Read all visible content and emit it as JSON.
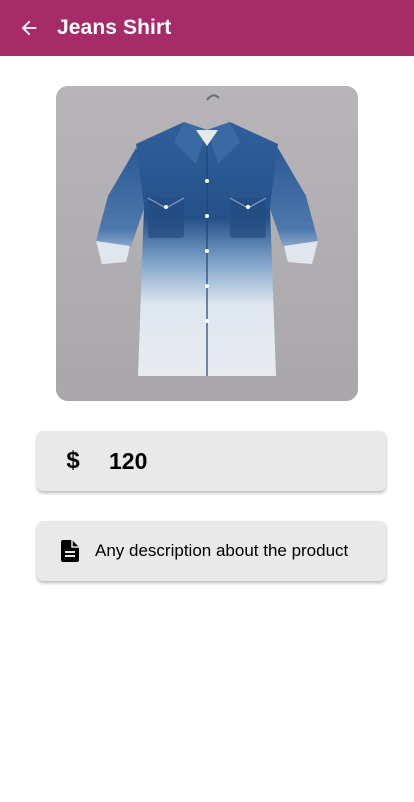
{
  "app_bar": {
    "title": "Jeans Shirt",
    "background_color": "#a62b68",
    "back_icon": "arrow-back-icon"
  },
  "product": {
    "image_icon": "jeans-shirt-photo"
  },
  "price": {
    "icon_glyph": "$",
    "value": "120"
  },
  "description": {
    "icon": "document-icon",
    "text": "Any description about the product"
  }
}
